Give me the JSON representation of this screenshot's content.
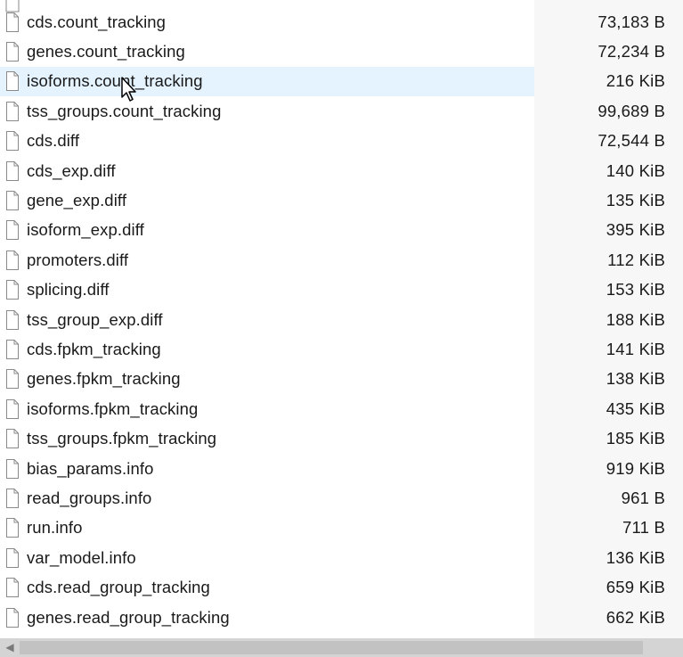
{
  "files": [
    {
      "name": "cds.count_tracking",
      "size": "73,183 B"
    },
    {
      "name": "genes.count_tracking",
      "size": "72,234 B"
    },
    {
      "name": "isoforms.count_tracking",
      "size": "216 KiB"
    },
    {
      "name": "tss_groups.count_tracking",
      "size": "99,689 B"
    },
    {
      "name": "cds.diff",
      "size": "72,544 B"
    },
    {
      "name": "cds_exp.diff",
      "size": "140 KiB"
    },
    {
      "name": "gene_exp.diff",
      "size": "135 KiB"
    },
    {
      "name": "isoform_exp.diff",
      "size": "395 KiB"
    },
    {
      "name": "promoters.diff",
      "size": "112 KiB"
    },
    {
      "name": "splicing.diff",
      "size": "153 KiB"
    },
    {
      "name": "tss_group_exp.diff",
      "size": "188 KiB"
    },
    {
      "name": "cds.fpkm_tracking",
      "size": "141 KiB"
    },
    {
      "name": "genes.fpkm_tracking",
      "size": "138 KiB"
    },
    {
      "name": "isoforms.fpkm_tracking",
      "size": "435 KiB"
    },
    {
      "name": "tss_groups.fpkm_tracking",
      "size": "185 KiB"
    },
    {
      "name": "bias_params.info",
      "size": "919 KiB"
    },
    {
      "name": "read_groups.info",
      "size": "961 B"
    },
    {
      "name": "run.info",
      "size": "711 B"
    },
    {
      "name": "var_model.info",
      "size": "136 KiB"
    },
    {
      "name": "cds.read_group_tracking",
      "size": "659 KiB"
    },
    {
      "name": "genes.read_group_tracking",
      "size": "662 KiB"
    }
  ],
  "hovered_file": "isoforms.count_tracking",
  "icons": {
    "file": "file-icon",
    "cursor": "mouse-pointer-icon",
    "scroll_left": "scroll-left-arrow-icon"
  },
  "colors": {
    "hover_highlight": "#e5f3ff",
    "text": "#1a1a1a",
    "scrollbar_track": "#d4d4d4"
  }
}
